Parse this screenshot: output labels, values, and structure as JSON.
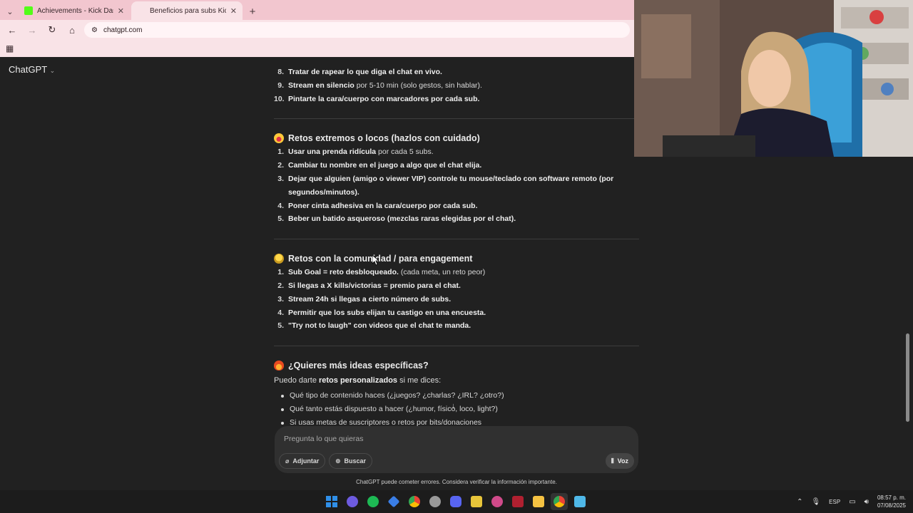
{
  "browser": {
    "tabs": [
      {
        "title": "Achievements - Kick Dashboard",
        "active": false,
        "favicon_color": "#53fc18"
      },
      {
        "title": "Beneficios para subs Kick",
        "active": true,
        "favicon_color": "#f9e3e7"
      }
    ],
    "address": "chatgpt.com"
  },
  "app": {
    "name": "ChatGPT"
  },
  "sections": {
    "top_list": [
      {
        "num": "8.",
        "bold": "Tratar de rapear lo que diga el chat en vivo.",
        "rest": ""
      },
      {
        "num": "9.",
        "bold": "Stream en silencio",
        "rest": " por 5-10 min (solo gestos, sin hablar)."
      },
      {
        "num": "10.",
        "bold": "Pintarte la cara/cuerpo con marcadores por cada sub.",
        "rest": ""
      }
    ],
    "extremos": {
      "title": "Retos extremos o locos (hazlos con cuidado)",
      "items": [
        {
          "num": "1.",
          "bold": "Usar una prenda ridícula",
          "rest": " por cada 5 subs."
        },
        {
          "num": "2.",
          "bold": "Cambiar tu nombre en el juego a algo que el chat elija.",
          "rest": ""
        },
        {
          "num": "3.",
          "bold": "Dejar que alguien (amigo o viewer VIP) controle tu mouse/teclado con software remoto (por segundos/minutos).",
          "rest": ""
        },
        {
          "num": "4.",
          "bold": "Poner cinta adhesiva en la cara/cuerpo por cada sub.",
          "rest": ""
        },
        {
          "num": "5.",
          "bold": "Beber un batido asqueroso (mezclas raras elegidas por el chat).",
          "rest": ""
        }
      ]
    },
    "comunidad": {
      "title": "Retos con la comunidad / para engagement",
      "items": [
        {
          "num": "1.",
          "bold": "Sub Goal = reto desbloqueado.",
          "rest": " (cada meta, un reto peor)"
        },
        {
          "num": "2.",
          "bold": "Si llegas a X kills/victorias = premio para el chat.",
          "rest": ""
        },
        {
          "num": "3.",
          "bold": "Stream 24h si llegas a cierto número de subs.",
          "rest": ""
        },
        {
          "num": "4.",
          "bold": "Permitir que los subs elijan tu castigo en una encuesta.",
          "rest": ""
        },
        {
          "num": "5.",
          "bold": "\"Try not to laugh\" con videos que el chat te manda.",
          "rest": ""
        }
      ]
    },
    "ideas": {
      "title": "¿Quieres más ideas específicas?",
      "intro_pre": "Puedo darte ",
      "intro_bold": "retos personalizados",
      "intro_post": " si me dices:",
      "bullets": [
        "Qué tipo de contenido haces (¿juegos? ¿charlas? ¿IRL? ¿otro?)",
        "Qué tanto estás dispuesto a hacer (¿humor, físico, loco, light?)",
        "Si usas metas de suscriptores o retos por bits/donaciones"
      ]
    }
  },
  "composer": {
    "placeholder": "Pregunta lo que quieras",
    "attach_label": "Adjuntar",
    "search_label": "Buscar",
    "voice_label": "Voz"
  },
  "footnote": "ChatGPT puede cometer errores. Considera verificar la información importante.",
  "taskbar": {
    "lang": "ESP",
    "time": "08:57 p. m.",
    "date": "07/08/2025",
    "app_icon_colors": [
      "#2f8fe8",
      "#6d5be0",
      "#1db954",
      "#3a7ee6",
      "#e8a53a",
      "#999999",
      "#5865f2",
      "#e8c53a",
      "#d04a8a",
      "#b02030",
      "#f5c242",
      "#3a7ee6",
      "#4fb8e8"
    ]
  }
}
